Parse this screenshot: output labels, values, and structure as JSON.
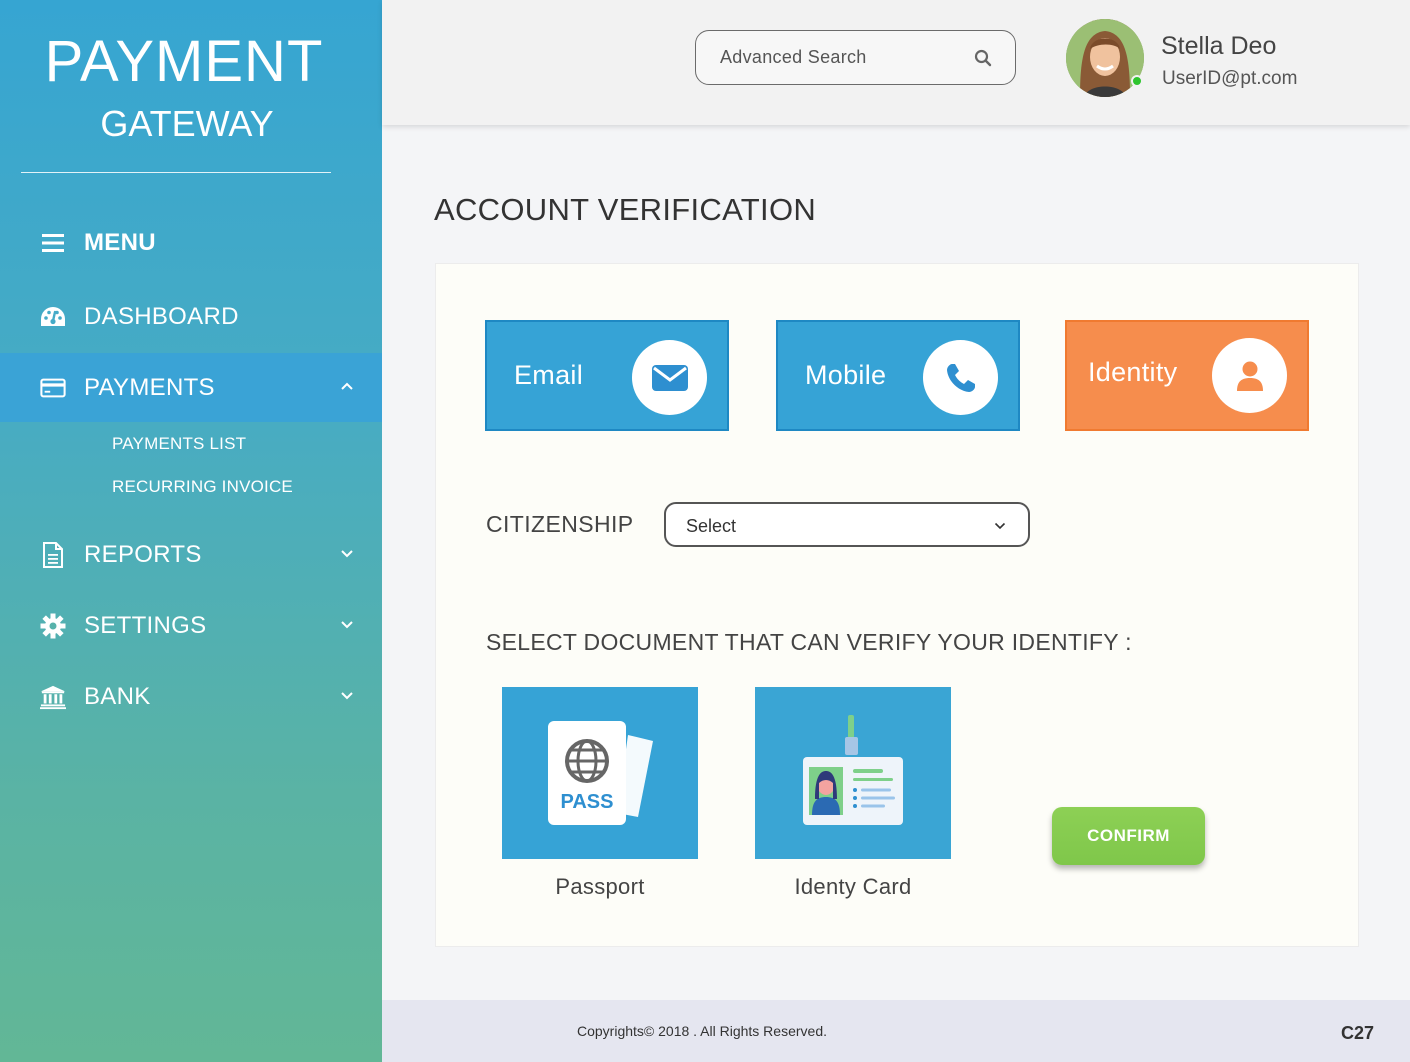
{
  "brand": {
    "top": "PAYMENT",
    "bottom": "GATEWAY"
  },
  "sidebar": {
    "items": [
      {
        "label": "MENU",
        "icon": "hamburger-icon"
      },
      {
        "label": "DASHBOARD",
        "icon": "dashboard-gauge-icon"
      },
      {
        "label": "PAYMENTS",
        "icon": "credit-card-icon",
        "expanded": true,
        "children": [
          {
            "label": "PAYMENTS LIST"
          },
          {
            "label": "RECURRING INVOICE"
          }
        ]
      },
      {
        "label": "REPORTS",
        "icon": "document-icon",
        "expanded": false
      },
      {
        "label": "SETTINGS",
        "icon": "gear-icon",
        "expanded": false
      },
      {
        "label": "BANK",
        "icon": "bank-icon",
        "expanded": false
      }
    ]
  },
  "header": {
    "search_placeholder": "Advanced Search",
    "user": {
      "name": "Stella Deo",
      "email": "UserID@pt.com",
      "online": true
    }
  },
  "main": {
    "title": "ACCOUNT VERIFICATION",
    "verification_methods": [
      {
        "label": "Email",
        "icon": "envelope-icon",
        "color": "#36a3d6"
      },
      {
        "label": "Mobile",
        "icon": "phone-icon",
        "color": "#36a3d6"
      },
      {
        "label": "Identity",
        "icon": "user-icon",
        "color": "#f68d4d",
        "selected": true
      }
    ],
    "citizenship": {
      "label": "CITIZENSHIP",
      "value": "Select"
    },
    "documents_heading": "SELECT DOCUMENT THAT CAN VERIFY YOUR IDENTIFY :",
    "documents": [
      {
        "label": "Passport",
        "icon": "passport-icon",
        "badge": "PASS"
      },
      {
        "label": "Identy Card",
        "icon": "id-card-icon"
      }
    ],
    "confirm_label": "CONFIRM"
  },
  "footer": {
    "copyright": "Copyrights© 2018 . All Rights Reserved.",
    "code": "C27"
  },
  "colors": {
    "sidebar_top": "#36a5d2",
    "sidebar_bottom": "#62b796",
    "blue": "#36a3d6",
    "orange": "#f68d4d",
    "green": "#8dd055"
  }
}
